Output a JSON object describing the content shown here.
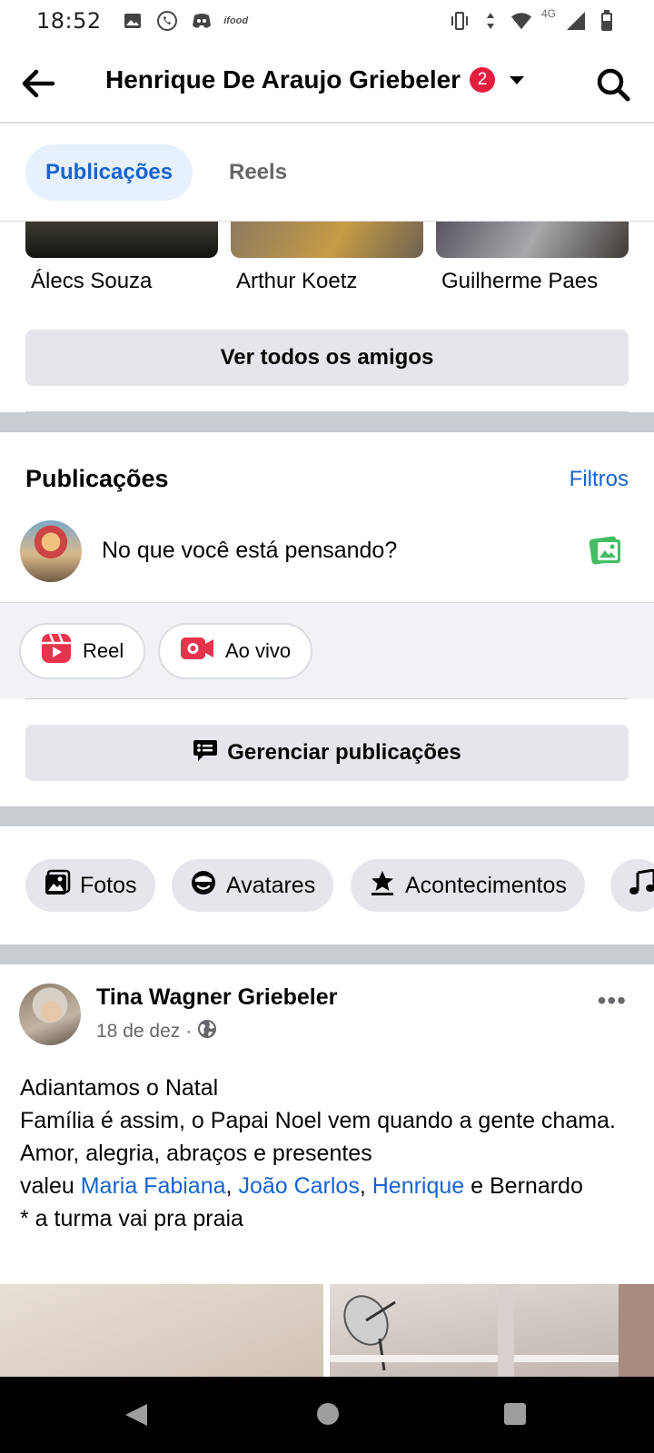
{
  "status_bar": {
    "time": "18:52",
    "left_icons": [
      "image-icon",
      "whatsapp-icon",
      "discord-icon",
      "ifood-icon"
    ],
    "ifood_label": "ifood",
    "network": "4G",
    "right_icons": [
      "vibrate-icon",
      "data-arrows-icon",
      "wifi-icon",
      "signal-icon",
      "battery-icon"
    ]
  },
  "header": {
    "title": "Henrique De Araujo Griebeler",
    "notification_count": "2",
    "icons": {
      "back": "arrow-left-icon",
      "dropdown": "caret-down-icon",
      "search": "search-icon"
    }
  },
  "tabs": [
    {
      "label": "Publicações",
      "active": true
    },
    {
      "label": "Reels",
      "active": false
    }
  ],
  "friends": {
    "names": [
      "Álecs Souza",
      "Arthur Koetz",
      "Guilherme Paes"
    ],
    "view_all_label": "Ver todos os amigos"
  },
  "posts_section": {
    "title": "Publicações",
    "filters_label": "Filtros",
    "composer_placeholder": "No que você está pensando?",
    "actions": [
      {
        "label": "Reel",
        "icon": "reel-icon"
      },
      {
        "label": "Ao vivo",
        "icon": "live-video-icon"
      }
    ],
    "manage_label": "Gerenciar publicações"
  },
  "categories": [
    {
      "label": "Fotos",
      "icon": "photos-icon"
    },
    {
      "label": "Avatares",
      "icon": "avatar-icon"
    },
    {
      "label": "Acontecimentos",
      "icon": "life-event-icon"
    },
    {
      "label": "",
      "icon": "music-icon"
    }
  ],
  "post": {
    "author": "Tina Wagner Griebeler",
    "date": "18 de dez",
    "separator": "·",
    "lines": [
      "Adiantamos o Natal",
      "Família é assim, o Papai Noel vem quando a gente chama.",
      "Amor, alegria, abraços e presentes"
    ],
    "mention_prefix": "valeu",
    "mentions": [
      "Maria Fabiana",
      "João Carlos",
      "Henrique"
    ],
    "mention_tail": "e Bernardo",
    "last_line": "* a turma vai pra praia"
  },
  "colors": {
    "accent": "#1763cf",
    "badge": "#e41e3f",
    "reel": "#e8334d",
    "photo_green": "#45bd62"
  }
}
